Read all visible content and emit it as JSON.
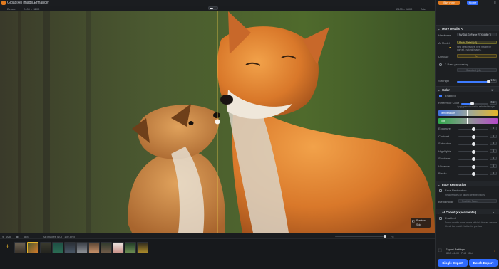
{
  "app": {
    "title": "Gigapixel Image Enhancer"
  },
  "toolbar": {
    "left_a": "Before",
    "left_b": "2400 × 3200",
    "right_a": "2400 × 4800",
    "right_b": "After"
  },
  "panel_top": {
    "buy_label": "Buy now",
    "home_label": "Home"
  },
  "more_details": {
    "header": "More Details AI",
    "hardware_label": "Hardware",
    "hardware_value": "NVIDIA GeForce RTX 4080 Ti",
    "ai_model_label": "AI Model",
    "ai_model_value": "Photo Detail (v2)",
    "note": "Fine detail restore, best results for portrait / natural images.",
    "upscale_label": "Upscale",
    "upscale_value": "2x",
    "twopass_label": "2-Pass processing",
    "twopass_field": "Standard (v4)",
    "strength_label": "Strength",
    "strength_value": "1.00",
    "strength_level": 1.0
  },
  "color": {
    "header": "Color",
    "enabled_label": "Enabled",
    "ref_label": "Reference Color",
    "ref_value": "0.41",
    "ref_level": 0.41,
    "note": "Apply preset color for selected images",
    "temperature_label": "Temperature",
    "tint_label": "Tint",
    "rows": [
      {
        "label": "Exposure",
        "value": "0"
      },
      {
        "label": "Contrast",
        "value": "0"
      },
      {
        "label": "Saturation",
        "value": "0"
      },
      {
        "label": "Highlights",
        "value": "0"
      },
      {
        "label": "Shadows",
        "value": "0"
      },
      {
        "label": "Vibrance",
        "value": "0"
      },
      {
        "label": "Blacks",
        "value": "0"
      }
    ]
  },
  "face": {
    "header": "Face Restoration",
    "enable_label": "Face Restoration",
    "note": "Restore faces on all and detected faces",
    "blend_label": "Blend mode",
    "blend_value": "Realistic Faces"
  },
  "ai_crowd": {
    "header": "AI Crowd (experimental)",
    "enabled_label": "Enabled",
    "line1": "Do not enable crowd mode with this feature are needed",
    "line2": "Check the model / button for preview"
  },
  "export": {
    "settings_label": "Export Settings",
    "settings_value": "4800 × 6400 · PNG · 8-bit",
    "single_label": "Single Export",
    "batch_label": "Batch Export"
  },
  "bottombar": {
    "add": "Add",
    "count": "8/8",
    "crumb": "All Images (10) / 192.png",
    "zoom_label": "Fit"
  },
  "overlay": {
    "line1": "Preview",
    "line2": "Side"
  },
  "colors": {
    "accent": "#2f6bff",
    "orange": "#e07a1f",
    "selected": "#e6b52a"
  }
}
